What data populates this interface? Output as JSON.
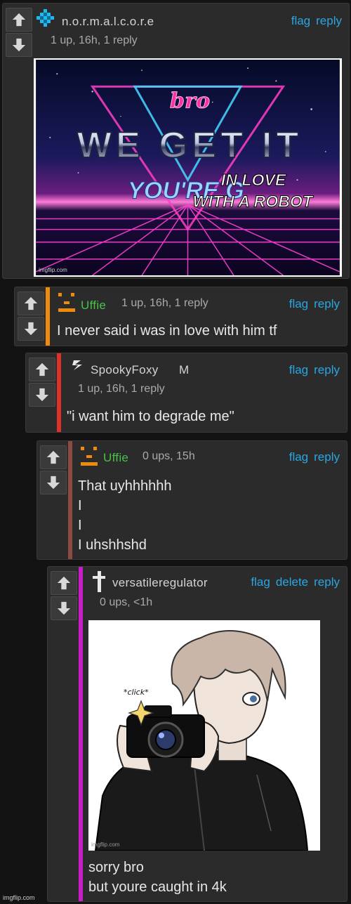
{
  "comments": [
    {
      "username": "n.o.r.m.a.l.c.o.r.e",
      "meta": "1 up, 16h, 1 reply",
      "actions": [
        "flag",
        "reply"
      ],
      "meme": {
        "bro": "bro",
        "line1": "WE GET IT",
        "line2": "YOU'RE G",
        "overlay1": "IN LOVE",
        "overlay2": "WITH A ROBOT",
        "watermark": "imgflip.com"
      }
    },
    {
      "username": "Uffie",
      "meta": "1 up, 16h, 1 reply",
      "actions": [
        "flag",
        "reply"
      ],
      "text": "I never said i was in love with him tf",
      "bar_color": "#f08a0c"
    },
    {
      "username": "SpookyFoxy",
      "badge": "M",
      "meta": "1 up, 16h, 1 reply",
      "actions": [
        "flag",
        "reply"
      ],
      "text": "\"i want him to degrade me\"",
      "bar_color": "#e0302a"
    },
    {
      "username": "Uffie",
      "meta": "0 ups, 15h",
      "actions": [
        "flag",
        "reply"
      ],
      "text": "That uyhhhhhh\nI\nI\nI uhshhshd",
      "bar_color": "#8c4a43"
    },
    {
      "username": "versatileregulator",
      "meta": "0 ups, <1h",
      "actions": [
        "flag",
        "delete",
        "reply"
      ],
      "text": "sorry bro\nbut youre caught in 4k",
      "bar_color": "#c81ec8",
      "image_caption": "*click*",
      "watermark": "imgflip.com"
    }
  ],
  "colors": {
    "link": "#2aa6e2",
    "username": "#d4d4d4",
    "uffie": "#49c149"
  },
  "footer_watermark": "imgflip.com"
}
